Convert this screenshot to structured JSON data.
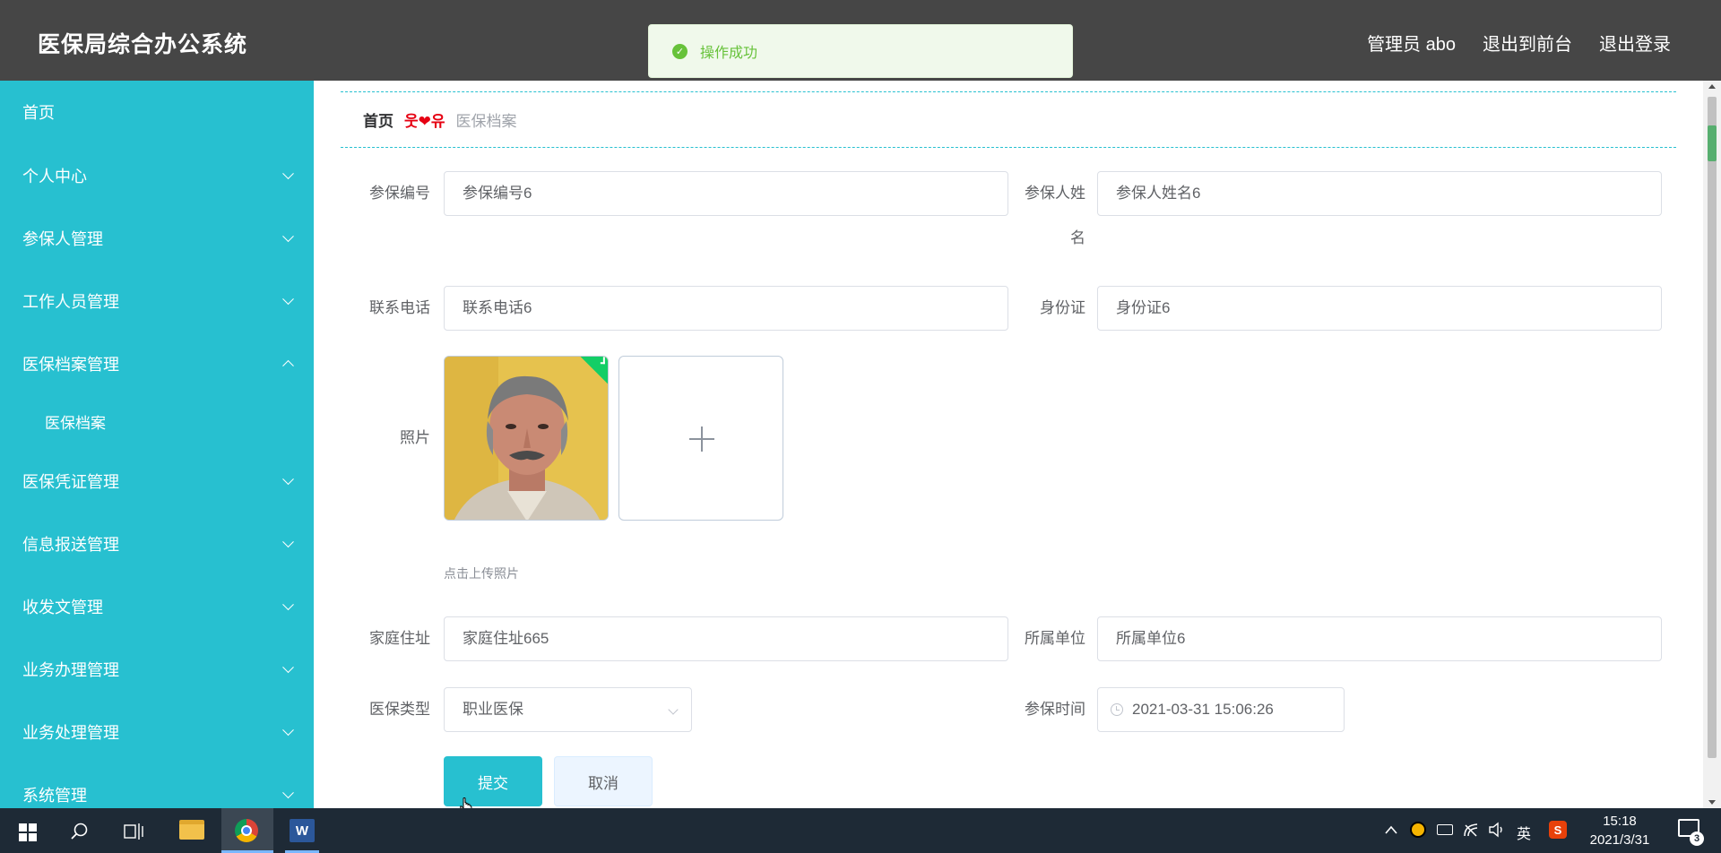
{
  "header": {
    "app_title": "医保局综合办公系统",
    "admin_label": "管理员 abo",
    "to_frontend": "退出到前台",
    "logout": "退出登录"
  },
  "toast": {
    "message": "操作成功",
    "icon": "success-check-icon"
  },
  "sidebar": {
    "items": [
      {
        "label": "首页"
      },
      {
        "label": "个人中心"
      },
      {
        "label": "参保人管理"
      },
      {
        "label": "工作人员管理"
      },
      {
        "label": "医保档案管理",
        "expanded": true
      },
      {
        "label": "医保档案"
      },
      {
        "label": "医保凭证管理"
      },
      {
        "label": "信息报送管理"
      },
      {
        "label": "收发文管理"
      },
      {
        "label": "业务办理管理"
      },
      {
        "label": "业务处理管理"
      },
      {
        "label": "系统管理"
      }
    ]
  },
  "breadcrumb": {
    "home": "首页",
    "separator": "웃❤유",
    "current": "医保档案"
  },
  "form": {
    "insured_no": {
      "label": "参保编号",
      "value": "参保编号6"
    },
    "insured_name": {
      "label": "参保人姓名",
      "label_line1": "参保人姓",
      "label_line2": "名",
      "value": "参保人姓名6"
    },
    "phone": {
      "label": "联系电话",
      "value": "联系电话6"
    },
    "id_card": {
      "label": "身份证",
      "value": "身份证6"
    },
    "photo": {
      "label": "照片",
      "hint": "点击上传照片"
    },
    "address": {
      "label": "家庭住址",
      "value": "家庭住址665"
    },
    "unit": {
      "label": "所属单位",
      "value": "所属单位6"
    },
    "insurance_type": {
      "label": "医保类型",
      "value": "职业医保"
    },
    "insure_time": {
      "label": "参保时间",
      "value": "2021-03-31 15:06:26"
    },
    "submit": "提交",
    "cancel": "取消"
  },
  "taskbar": {
    "ime": "英",
    "time": "15:18",
    "date": "2021/3/31",
    "notification_count": "3"
  },
  "colors": {
    "accent": "#27c0d0",
    "header_bg": "#464646",
    "success": "#67c23a"
  }
}
